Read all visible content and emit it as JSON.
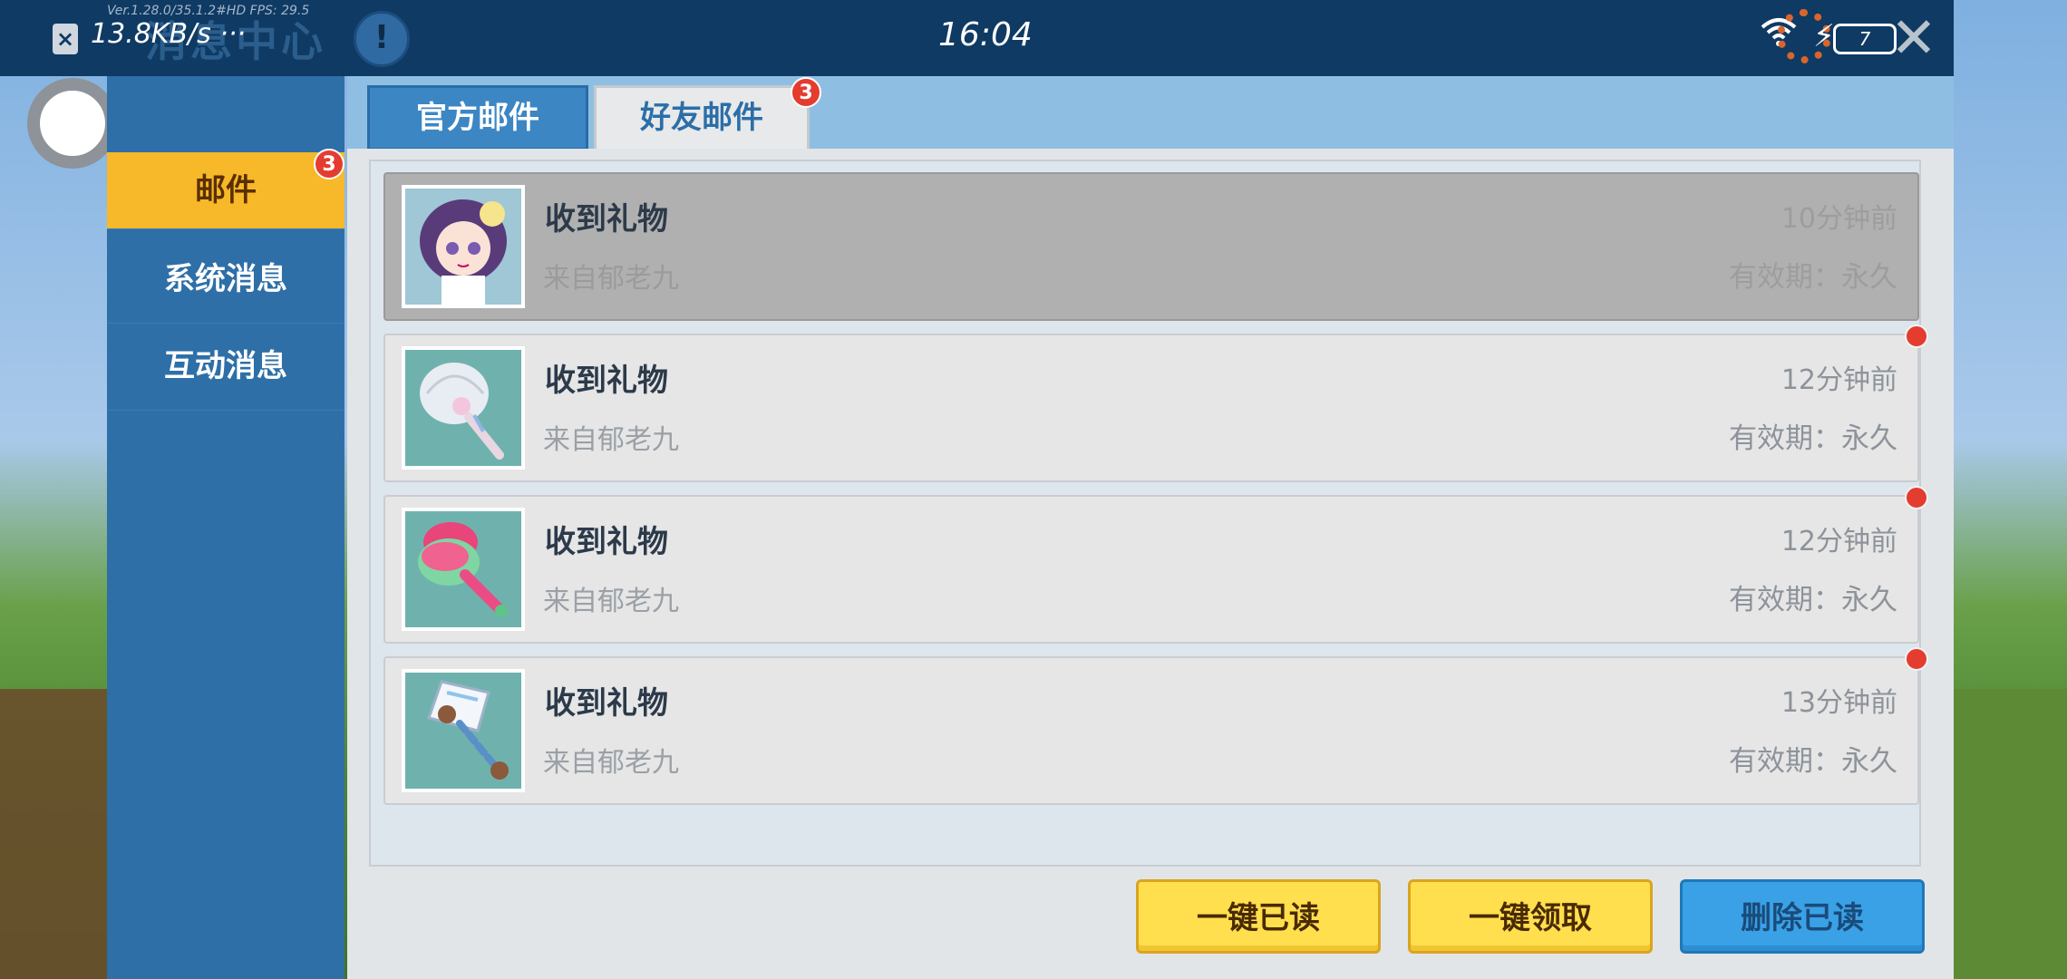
{
  "status_bar": {
    "version_text": "Ver.1.28.0/35.1.2#HD FPS: 29.5",
    "net_speed": "13.8KB/s ···",
    "time": "16:04",
    "battery": "7"
  },
  "header": {
    "title": "消息中心",
    "info_icon": "exclamation-icon",
    "close_icon": "close-icon"
  },
  "sidebar": {
    "items": [
      {
        "label": "邮件",
        "badge": "3"
      },
      {
        "label": "系统消息"
      },
      {
        "label": "互动消息"
      }
    ]
  },
  "tabs": [
    {
      "label": "官方邮件"
    },
    {
      "label": "好友邮件",
      "badge": "3"
    }
  ],
  "mails": [
    {
      "title": "收到礼物",
      "from": "来自郁老九",
      "time": "10分钟前",
      "expiry": "有效期：永久",
      "icon": "character-portrait-icon"
    },
    {
      "title": "收到礼物",
      "from": "来自郁老九",
      "time": "12分钟前",
      "expiry": "有效期：永久",
      "icon": "shell-wand-icon"
    },
    {
      "title": "收到礼物",
      "from": "来自郁老九",
      "time": "12分钟前",
      "expiry": "有效期：永久",
      "icon": "watermelon-hammer-icon"
    },
    {
      "title": "收到礼物",
      "from": "来自郁老九",
      "time": "13分钟前",
      "expiry": "有效期：永久",
      "icon": "bear-paw-axe-icon"
    }
  ],
  "buttons": {
    "read_all": "一键已读",
    "claim_all": "一键领取",
    "delete_read": "删除已读"
  },
  "colors": {
    "sidebar": "#2e6fa8",
    "active_tab": "#f7b829",
    "badge": "#e43c2f",
    "button_yellow": "#ffdf4d",
    "button_blue": "#3aa1e6"
  }
}
